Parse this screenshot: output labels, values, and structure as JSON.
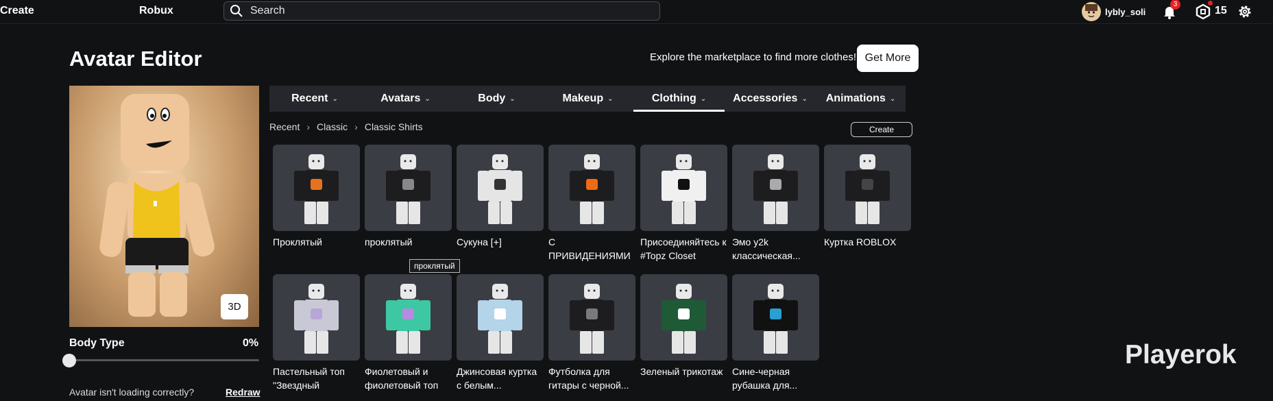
{
  "nav": {
    "create": "Create",
    "robux": "Robux",
    "search_placeholder": "Search",
    "username": "lybly_soli",
    "notification_count": "3",
    "robux_balance": "15"
  },
  "page": {
    "title": "Avatar Editor",
    "promo_text": "Explore the marketplace to find more clothes!",
    "get_more": "Get More",
    "view_mode": "3D",
    "body_type_label": "Body Type",
    "body_type_value": "0%",
    "redraw_question": "Avatar isn't loading correctly?",
    "redraw_link": "Redraw",
    "create_button": "Create",
    "tooltip": "проклятый",
    "watermark": "Playerok"
  },
  "tabs": [
    {
      "label": "Recent",
      "active": false
    },
    {
      "label": "Avatars",
      "active": false
    },
    {
      "label": "Body",
      "active": false
    },
    {
      "label": "Makeup",
      "active": false
    },
    {
      "label": "Clothing",
      "active": true
    },
    {
      "label": "Accessories",
      "active": false
    },
    {
      "label": "Animations",
      "active": false
    }
  ],
  "breadcrumb": [
    "Recent",
    "Classic",
    "Classic Shirts"
  ],
  "items": [
    {
      "name": "Проклятый",
      "shirt": "#1d1d1f",
      "accent": "#e8721c"
    },
    {
      "name": "проклятый",
      "shirt": "#1d1d1f",
      "accent": "#888888"
    },
    {
      "name": "Сукуна [+]",
      "shirt": "#e5e5e5",
      "accent": "#333333"
    },
    {
      "name": "С ПРИВИДЕНИЯМИ",
      "shirt": "#1d1d1f",
      "accent": "#ef6a14"
    },
    {
      "name": "Присоединяйтесь к #Topz Closet",
      "shirt": "#f0f0f0",
      "accent": "#111111"
    },
    {
      "name": "Эмо y2k классическая...",
      "shirt": "#1d1d1f",
      "accent": "#aaaaaa"
    },
    {
      "name": "Куртка ROBLOX",
      "shirt": "#1d1d1f",
      "accent": "#444444"
    },
    {
      "name": "Пастельный топ \"Звездный взрыв\"...",
      "shirt": "#c9c9d6",
      "accent": "#b8a6d8"
    },
    {
      "name": "Фиолетовый и фиолетовый топ",
      "shirt": "#3ec7a3",
      "accent": "#b58be0"
    },
    {
      "name": "Джинсовая куртка с белым...",
      "shirt": "#b4d4ea",
      "accent": "#ffffff"
    },
    {
      "name": "Футболка для гитары с черной...",
      "shirt": "#1d1d1f",
      "accent": "#7a7a7a"
    },
    {
      "name": "Зеленый трикотаж",
      "shirt": "#1f5a37",
      "accent": "#ffffff"
    },
    {
      "name": "Сине-черная рубашка для...",
      "shirt": "#111111",
      "accent": "#2a9fd1"
    }
  ]
}
